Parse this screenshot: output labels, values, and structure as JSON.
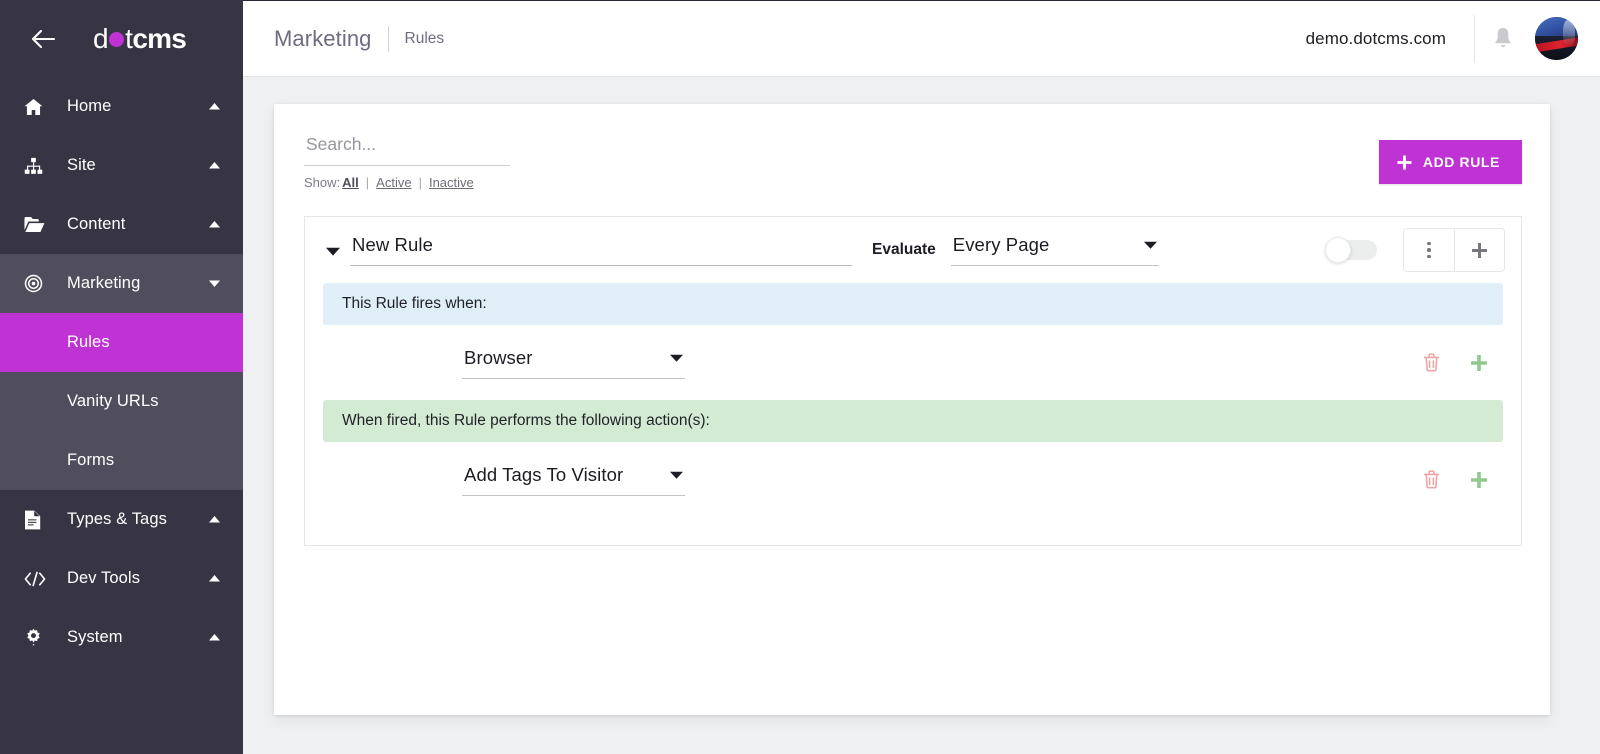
{
  "brand": {
    "logo_text_left": "d",
    "logo_dot_icon": "purple-dot",
    "logo_text_mid": "t",
    "logo_text_bold": "cms",
    "back_icon": "arrow-left-icon"
  },
  "sidebar": {
    "items": [
      {
        "label": "Home",
        "icon": "home-icon",
        "chevron": "chevron-up-icon",
        "state": "collapsed"
      },
      {
        "label": "Site",
        "icon": "sitemap-icon",
        "chevron": "chevron-up-icon",
        "state": "collapsed"
      },
      {
        "label": "Content",
        "icon": "folder-open-icon",
        "chevron": "chevron-up-icon",
        "state": "collapsed"
      },
      {
        "label": "Marketing",
        "icon": "target-icon",
        "chevron": "chevron-down-icon",
        "state": "expanded"
      },
      {
        "label": "Types & Tags",
        "icon": "document-icon",
        "chevron": "chevron-up-icon",
        "state": "collapsed"
      },
      {
        "label": "Dev Tools",
        "icon": "code-icon",
        "chevron": "chevron-up-icon",
        "state": "collapsed"
      },
      {
        "label": "System",
        "icon": "gear-icon",
        "chevron": "chevron-up-icon",
        "state": "collapsed"
      }
    ],
    "marketing_submenu": [
      {
        "label": "Rules",
        "active": true
      },
      {
        "label": "Vanity URLs",
        "active": false
      },
      {
        "label": "Forms",
        "active": false
      }
    ],
    "active_color": "#bf32d4",
    "bg_color": "#373543",
    "expanded_bg_color": "#504e5c"
  },
  "topbar": {
    "breadcrumb_main": "Marketing",
    "breadcrumb_sub": "Rules",
    "site_name": "demo.dotcms.com",
    "bell_icon": "bell-icon",
    "avatar_icon": "user-avatar"
  },
  "toolbar": {
    "search_value": "",
    "search_placeholder": "Search...",
    "show_label": "Show:",
    "show_options": [
      {
        "label": "All",
        "selected": true
      },
      {
        "label": "Active",
        "selected": false
      },
      {
        "label": "Inactive",
        "selected": false
      }
    ],
    "pipe": "|",
    "add_rule_label": "ADD RULE",
    "add_rule_icon": "plus-icon",
    "add_rule_color": "#bf32d4"
  },
  "rule": {
    "expand_icon": "triangle-down-icon",
    "name_value": "New Rule",
    "name_placeholder": "",
    "evaluate_label": "Evaluate",
    "evaluate_value": "Every Page",
    "evaluate_caret_icon": "triangle-down-icon",
    "enabled": false,
    "toggle_state": "off",
    "menu_icon": "kebab-menu-icon",
    "add_icon": "plus-icon",
    "when_banner": "This Rule fires when:",
    "when_banner_color": "#dfeef7",
    "then_banner": "When fired, this Rule performs the following action(s):",
    "then_banner_color": "#d3ead3",
    "condition": {
      "value": "Browser",
      "caret_icon": "triangle-down-icon",
      "delete_icon": "trash-icon",
      "add_icon": "plus-icon"
    },
    "action": {
      "value": "Add Tags To Visitor",
      "caret_icon": "triangle-down-icon",
      "delete_icon": "trash-icon",
      "add_icon": "plus-icon"
    }
  }
}
